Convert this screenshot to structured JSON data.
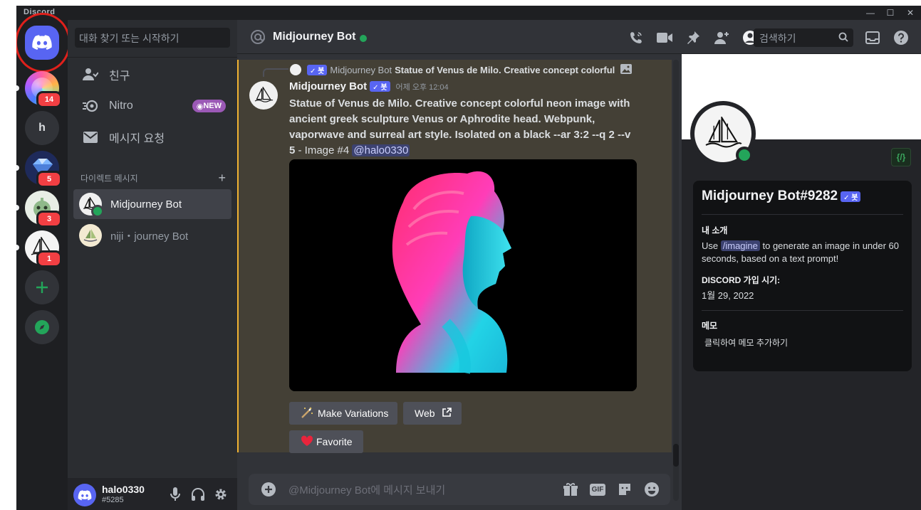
{
  "window": {
    "brand": "Discord",
    "minimize": "—",
    "maximize": "☐",
    "close": "✕"
  },
  "servers": [
    {
      "name": "home",
      "badge": ""
    },
    {
      "name": "server-gradient",
      "badge": "14"
    },
    {
      "name": "server-h",
      "initial": "h",
      "badge": ""
    },
    {
      "name": "server-gem",
      "badge": "5"
    },
    {
      "name": "server-green",
      "badge": "3"
    },
    {
      "name": "server-midjourney",
      "badge": "1"
    }
  ],
  "sidebar": {
    "search_placeholder": "대화 찾기 또는 시작하기",
    "nav": [
      {
        "label": "친구",
        "icon": "friends-icon"
      },
      {
        "label": "Nitro",
        "icon": "nitro-icon",
        "badge": "NEW"
      },
      {
        "label": "메시지 요청",
        "icon": "envelope-icon"
      }
    ],
    "dm_header": "다이렉트 메시지",
    "dm_add": "+",
    "dms": [
      {
        "name": "Midjourney Bot",
        "active": true
      },
      {
        "name": "niji・journey Bot",
        "active": false
      }
    ]
  },
  "user": {
    "name": "halo0330",
    "tag": "#5285"
  },
  "header": {
    "channel": "Midjourney Bot",
    "search_placeholder": "검색하기"
  },
  "message": {
    "reply_author": "Midjourney Bot",
    "reply_text": "Statue of Venus de Milo. Creative concept colorful",
    "bot_label": "✓ 봇",
    "author": "Midjourney Bot",
    "timestamp": "어제 오후 12:04",
    "content_bold": "Statue of Venus de Milo. Creative concept colorful neon image with ancient greek sculpture Venus or Aphrodite head. Webpunk, vaporwave and surreal art style. Isolated on a black --ar 3:2 --q 2 --v 5",
    "content_suffix": " - Image #4 ",
    "mention": "@halo0330",
    "buttons": {
      "variations": "Make Variations",
      "web": "Web",
      "favorite": "Favorite"
    }
  },
  "input": {
    "placeholder": "@Midjourney Bot에 메시지 보내기",
    "gif": "GIF"
  },
  "profile": {
    "dev_badge": "{/}",
    "name": "Midjourney Bot#9282",
    "bot_label": "✓ 봇",
    "about_label": "내 소개",
    "about_pre": "Use ",
    "about_cmd": "/imagine",
    "about_post": " to generate an image in under 60 seconds, based on a text prompt!",
    "joined_label": "DISCORD 가입 시기:",
    "joined_date": "1월 29, 2022",
    "note_label": "메모",
    "note_placeholder": "클릭하여 메모 추가하기"
  },
  "colors": {
    "blurple": "#5865f2",
    "online": "#23a55a",
    "danger": "#f23f43",
    "highlight_bar": "#f0b232"
  }
}
